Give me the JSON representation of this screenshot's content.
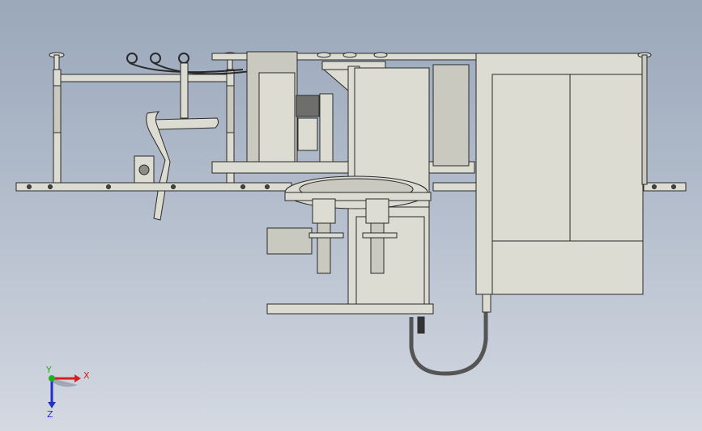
{
  "viewport": {
    "background_top": "#9aa8ba",
    "background_bottom": "#d4d9e2"
  },
  "model": {
    "part_fill": "#dcdcd2",
    "part_stroke": "#2a2a2a",
    "dark_fill": "#6e6e6a"
  },
  "triad": {
    "x_label": "X",
    "y_label": "Y",
    "z_label": "Z",
    "x_color": "#d42020",
    "y_color": "#1fb01f",
    "z_color": "#2030c8"
  }
}
